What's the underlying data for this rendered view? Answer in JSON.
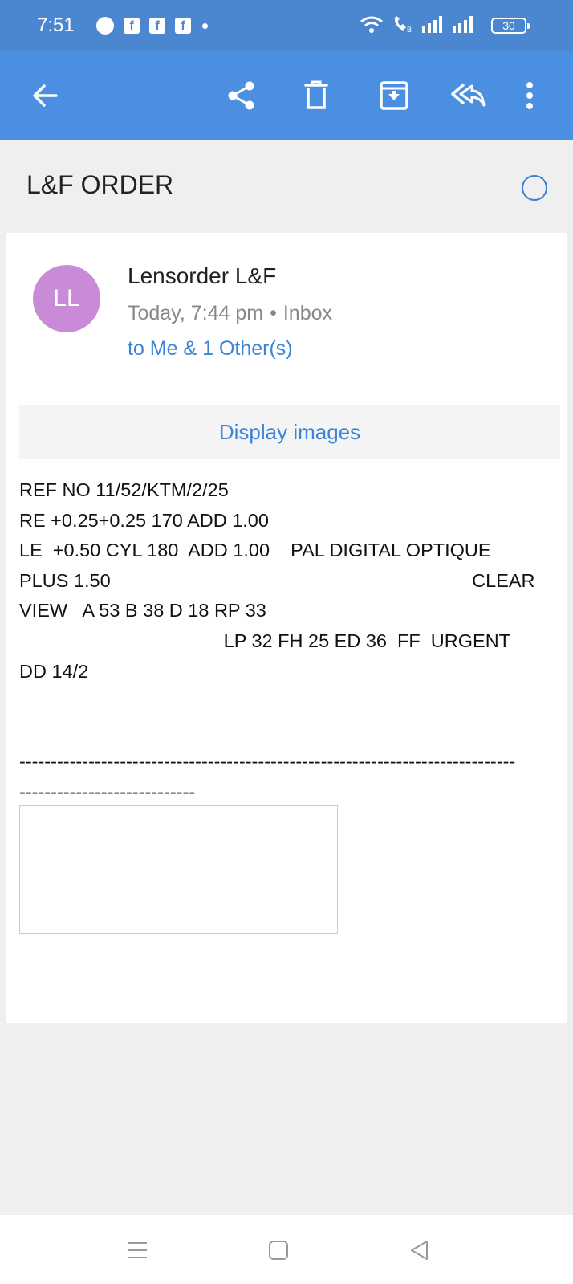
{
  "status_bar": {
    "time": "7:51",
    "battery": "30",
    "icons": [
      "messenger-icon",
      "facebook-icon",
      "facebook-icon",
      "facebook-icon",
      "dot-icon",
      "wifi-icon",
      "call-icon",
      "signal-icon",
      "signal-icon",
      "battery-icon"
    ]
  },
  "toolbar": {
    "actions": [
      "back-icon",
      "share-icon",
      "delete-icon",
      "archive-icon",
      "reply-icon",
      "more-icon"
    ]
  },
  "email": {
    "subject": "L&F ORDER",
    "sender": "Lensorder L&F",
    "avatar_initials": "LL",
    "time": "Today, 7:44 pm",
    "folder": "Inbox",
    "recipients": "to Me & 1 Other(s)",
    "display_images": "Display images",
    "body": "REF NO 11/52/KTM/2/25\nRE +0.25+0.25 170 ADD 1.00\nLE  +0.50 CYL 180  ADD 1.00    PAL DIGITAL OPTIQUE\nPLUS 1.50                                                                     CLEAR\nVIEW   A 53 B 38 D 18 RP 33\n                                       LP 32 FH 25 ED 36  FF  URGENT\nDD 14/2\n\n\n-------------------------------------------------------------------------------\n----------------------------"
  },
  "colors": {
    "status_bar": "#4b86d0",
    "toolbar": "#4a8fe2",
    "avatar": "#c98ad8",
    "link": "#3c84d8"
  }
}
